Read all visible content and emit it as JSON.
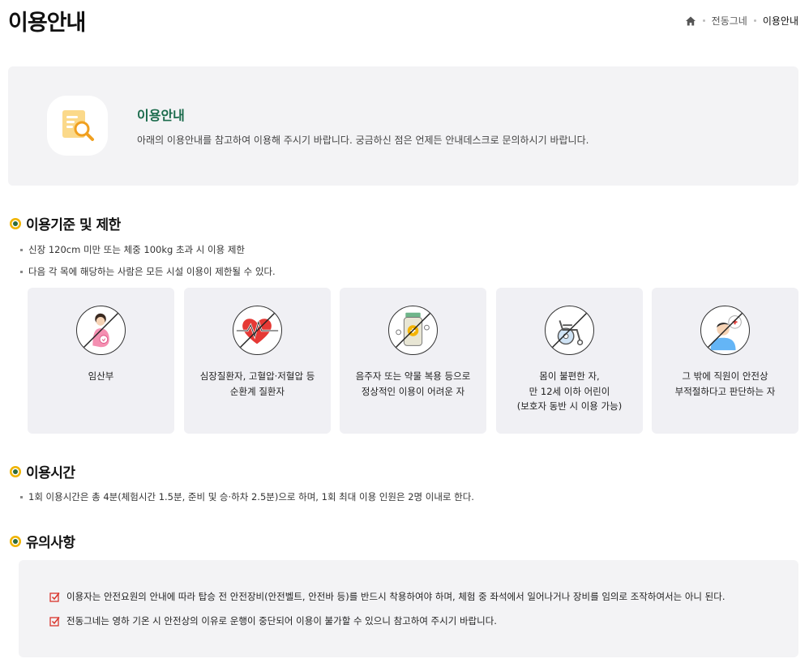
{
  "header": {
    "title": "이용안내",
    "breadcrumb": [
      "전동그네",
      "이용안내"
    ]
  },
  "intro": {
    "title": "이용안내",
    "desc": "아래의 이용안내를 참고하여 이용해 주시기 바랍니다. 궁금하신 점은 언제든 안내데스크로 문의하시기 바랍니다."
  },
  "restrictions": {
    "title": "이용기준 및 제한",
    "bullets": [
      "신장 120cm 미만 또는 체중 100kg 초과 시 이용 제한",
      "다음 각 목에 해당하는 사람은 모든 시설 이용이 제한될 수 있다."
    ],
    "cards": [
      {
        "icon": "pregnant-woman-icon",
        "label": "임산부"
      },
      {
        "icon": "heart-rate-icon",
        "label": "심장질환자, 고혈압·저혈압 등\n순환계 질환자"
      },
      {
        "icon": "medicine-bottle-icon",
        "label": "음주자 또는 약물 복용 등으로\n정상적인 이용이 어려운 자"
      },
      {
        "icon": "wheelchair-icon",
        "label": "몸이 불편한 자,\n만 12세 이하 어린이\n(보호자 동반 시 이용 가능)"
      },
      {
        "icon": "staff-icon",
        "label": "그 밖에 직원이 안전상\n부적절하다고 판단하는 자"
      }
    ]
  },
  "hours": {
    "title": "이용시간",
    "bullets": [
      "1회 이용시간은 총 4분(체험시간 1.5분, 준비 및 승·하차 2.5분)으로 하며, 1회 최대 이용 인원은 2명 이내로 한다."
    ]
  },
  "notice": {
    "title": "유의사항",
    "items": [
      "이용자는 안전요원의 안내에 따라 탑승 전 안전장비(안전벨트, 안전바 등)를 반드시 착용하여야 하며, 체험 중 좌석에서 일어나거나 장비를 임의로 조작하여서는 아니 된다.",
      "전동그네는 영하 기온 시 안전상의 이유로 운행이 중단되어 이용이 불가할 수 있으니 참고하여 주시기 바랍니다."
    ]
  },
  "colors": {
    "accent_green": "#1b6b4c",
    "dot_yellow": "#f0b400",
    "check_red": "#d9342b",
    "panel_bg": "#f3f3f5"
  }
}
